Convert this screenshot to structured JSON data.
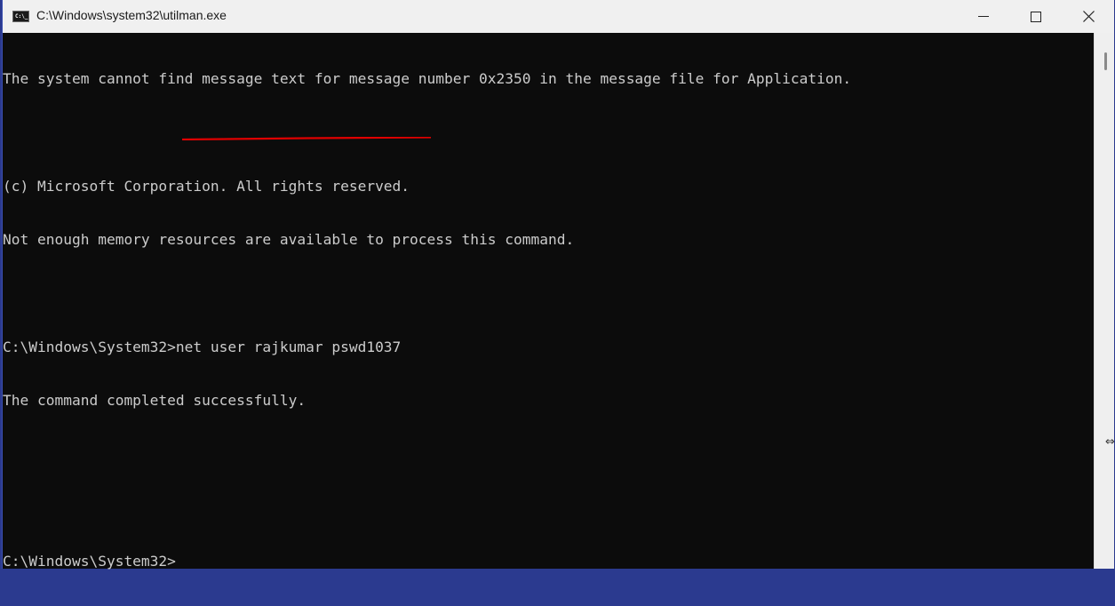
{
  "window": {
    "title": "C:\\Windows\\system32\\utilman.exe",
    "icon": "console-icon",
    "icon_glyph": "C:\\_",
    "controls": {
      "minimize": "minimize",
      "maximize": "maximize",
      "close": "close"
    }
  },
  "console": {
    "lines": [
      "The system cannot find message text for message number 0x2350 in the message file for Application.",
      "",
      "(c) Microsoft Corporation. All rights reserved.",
      "Not enough memory resources are available to process this command.",
      "",
      "C:\\Windows\\System32>net user rajkumar pswd1037",
      "The command completed successfully.",
      "",
      "",
      "C:\\Windows\\System32>"
    ],
    "highlighted_command": "net user rajkumar pswd1037",
    "annotation_color": "#e00000",
    "text_color": "#cccccc",
    "background_color": "#0c0c0c"
  }
}
